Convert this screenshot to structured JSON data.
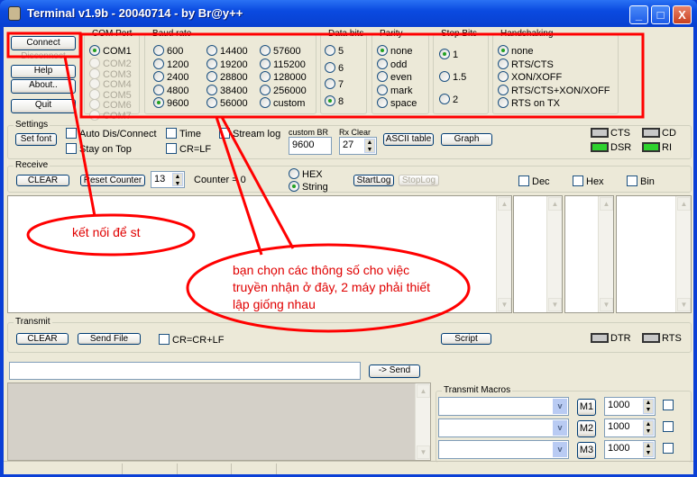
{
  "window": {
    "title": "Terminal v1.9b - 20040714 - by Br@y++",
    "minimize": "_",
    "maximize": "□",
    "close": "X"
  },
  "left_buttons": {
    "connect": "Connect",
    "disconnect": "Disconnect",
    "help": "Help",
    "about": "About..",
    "quit": "Quit"
  },
  "com_port": {
    "label": "COM Port",
    "options": [
      "COM1",
      "COM2",
      "COM3",
      "COM4",
      "COM5",
      "COM6",
      "COM7"
    ],
    "selected": "COM1"
  },
  "baud_rate": {
    "label": "Baud rate",
    "options": [
      "600",
      "1200",
      "2400",
      "4800",
      "9600",
      "14400",
      "19200",
      "28800",
      "38400",
      "56000",
      "57600",
      "115200",
      "128000",
      "256000",
      "custom"
    ],
    "selected": "9600"
  },
  "data_bits": {
    "label": "Data bits",
    "options": [
      "5",
      "6",
      "7",
      "8"
    ],
    "selected": "8"
  },
  "parity": {
    "label": "Parity",
    "options": [
      "none",
      "odd",
      "even",
      "mark",
      "space"
    ],
    "selected": "none"
  },
  "stop_bits": {
    "label": "Stop Bits",
    "options": [
      "1",
      "1.5",
      "2"
    ],
    "selected": "1"
  },
  "handshaking": {
    "label": "Handshaking",
    "options": [
      "none",
      "RTS/CTS",
      "XON/XOFF",
      "RTS/CTS+XON/XOFF",
      "RTS on TX"
    ],
    "selected": "none"
  },
  "settings": {
    "label": "Settings",
    "set_font": "Set font",
    "auto_dis_connect": "Auto Dis/Connect",
    "stay_on_top": "Stay on Top",
    "time": "Time",
    "cr_lf": "CR=LF",
    "stream_log": "Stream log",
    "custom_br_label": "custom BR",
    "custom_br_value": "9600",
    "rx_clear_label": "Rx Clear",
    "rx_clear_value": "27",
    "ascii_table": "ASCII table",
    "graph": "Graph",
    "cts": "CTS",
    "cd": "CD",
    "dsr": "DSR",
    "ri": "RI"
  },
  "receive": {
    "label": "Receive",
    "clear": "CLEAR",
    "reset_counter": "Reset Counter",
    "counter_spin": "13",
    "counter": "Counter = 0",
    "hex": "HEX",
    "string": "String",
    "mode_selected": "String",
    "start_log": "StartLog",
    "stop_log": "StopLog",
    "dec": "Dec",
    "hex_chk": "Hex",
    "bin": "Bin"
  },
  "transmit": {
    "label": "Transmit",
    "clear": "CLEAR",
    "send_file": "Send File",
    "cr_crlf": "CR=CR+LF",
    "script": "Script",
    "dtr": "DTR",
    "rts": "RTS",
    "input_value": "",
    "send": "-> Send"
  },
  "macros": {
    "label": "Transmit Macros",
    "rows": [
      {
        "button": "M1",
        "delay": "1000"
      },
      {
        "button": "M2",
        "delay": "1000"
      },
      {
        "button": "M3",
        "delay": "1000"
      }
    ]
  },
  "annotations": {
    "connect_note": "kết nối để st",
    "settings_note": [
      "bạn chọn các thông số cho việc",
      "truyền nhận ở đây, 2 máy phải thiết",
      "lập giống nhau"
    ]
  }
}
